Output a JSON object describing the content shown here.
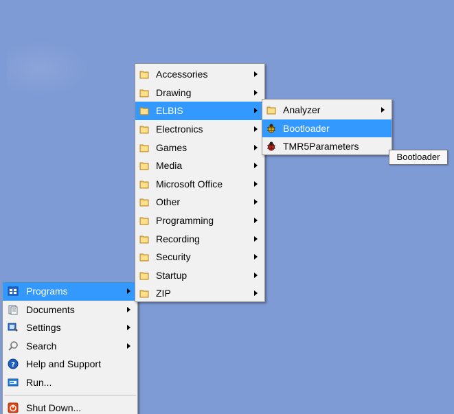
{
  "start_menu": {
    "items": [
      {
        "label": "Programs",
        "icon": "programs-icon",
        "submenu": true,
        "active": true
      },
      {
        "label": "Documents",
        "icon": "documents-icon",
        "submenu": true
      },
      {
        "label": "Settings",
        "icon": "settings-icon",
        "submenu": true
      },
      {
        "label": "Search",
        "icon": "search-icon",
        "submenu": true
      },
      {
        "label": "Help and Support",
        "icon": "help-icon",
        "submenu": false
      },
      {
        "label": "Run...",
        "icon": "run-icon",
        "submenu": false
      },
      {
        "label": "Shut Down...",
        "icon": "shutdown-icon",
        "submenu": false
      }
    ]
  },
  "programs_menu": {
    "items": [
      {
        "label": "Accessories"
      },
      {
        "label": "Drawing"
      },
      {
        "label": "ELBIS",
        "active": true
      },
      {
        "label": "Electronics"
      },
      {
        "label": "Games"
      },
      {
        "label": "Media"
      },
      {
        "label": "Microsoft Office"
      },
      {
        "label": "Other"
      },
      {
        "label": "Programming"
      },
      {
        "label": "Recording"
      },
      {
        "label": "Security"
      },
      {
        "label": "Startup"
      },
      {
        "label": "ZIP"
      }
    ]
  },
  "elbis_menu": {
    "items": [
      {
        "label": "Analyzer",
        "icon": "folder-icon",
        "submenu": true
      },
      {
        "label": "Bootloader",
        "icon": "bug-icon",
        "submenu": false,
        "active": true
      },
      {
        "label": "TMR5Parameters",
        "icon": "bug-red-icon",
        "submenu": false
      }
    ]
  },
  "tooltip": {
    "text": "Bootloader"
  },
  "colors": {
    "desktop": "#7f9bd5",
    "highlight": "#3399ff",
    "menu_bg": "#f1f1f1"
  }
}
